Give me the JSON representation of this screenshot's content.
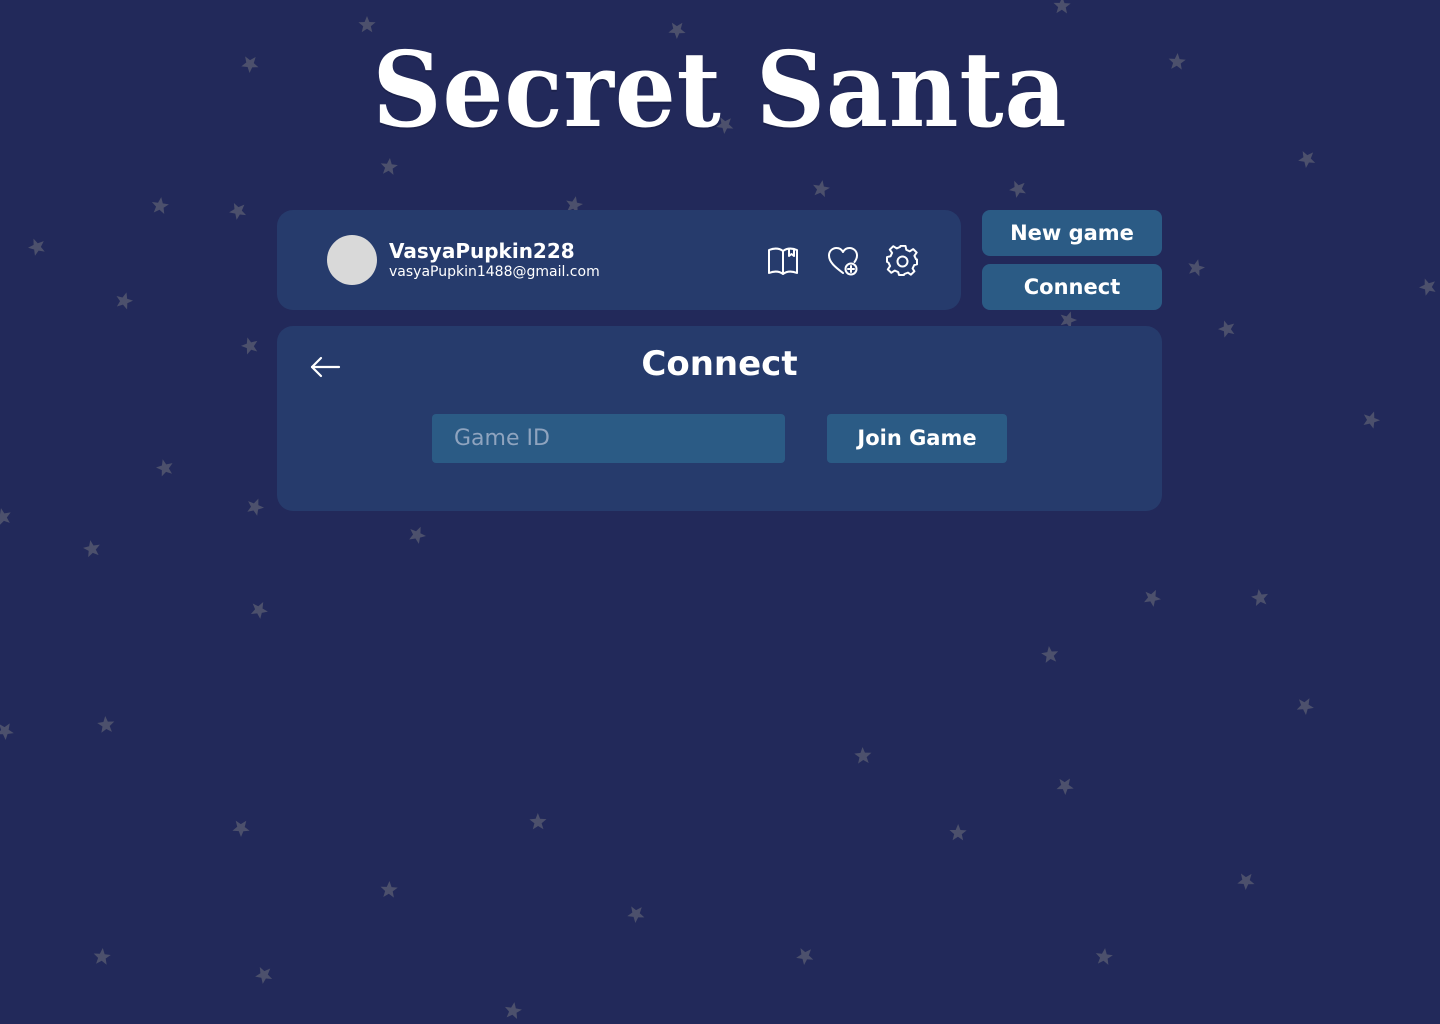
{
  "app": {
    "title": "Secret Santa"
  },
  "user": {
    "name": "VasyaPupkin228",
    "email": "vasyaPupkin1488@gmail.com"
  },
  "profile_icons": [
    "rules-book-icon",
    "wishlist-heart-plus-icon",
    "settings-gear-icon"
  ],
  "actions": {
    "new_game_label": "New game",
    "connect_label": "Connect"
  },
  "connect_panel": {
    "title": "Connect",
    "back_icon": "arrow-left-icon",
    "game_id_placeholder": "Game ID",
    "game_id_value": "",
    "join_label": "Join Game"
  },
  "colors": {
    "background": "#22295a",
    "card": "#263b6c",
    "button": "#2b5b85",
    "avatar": "#d9d9d9",
    "star": "#4a4f6a"
  }
}
